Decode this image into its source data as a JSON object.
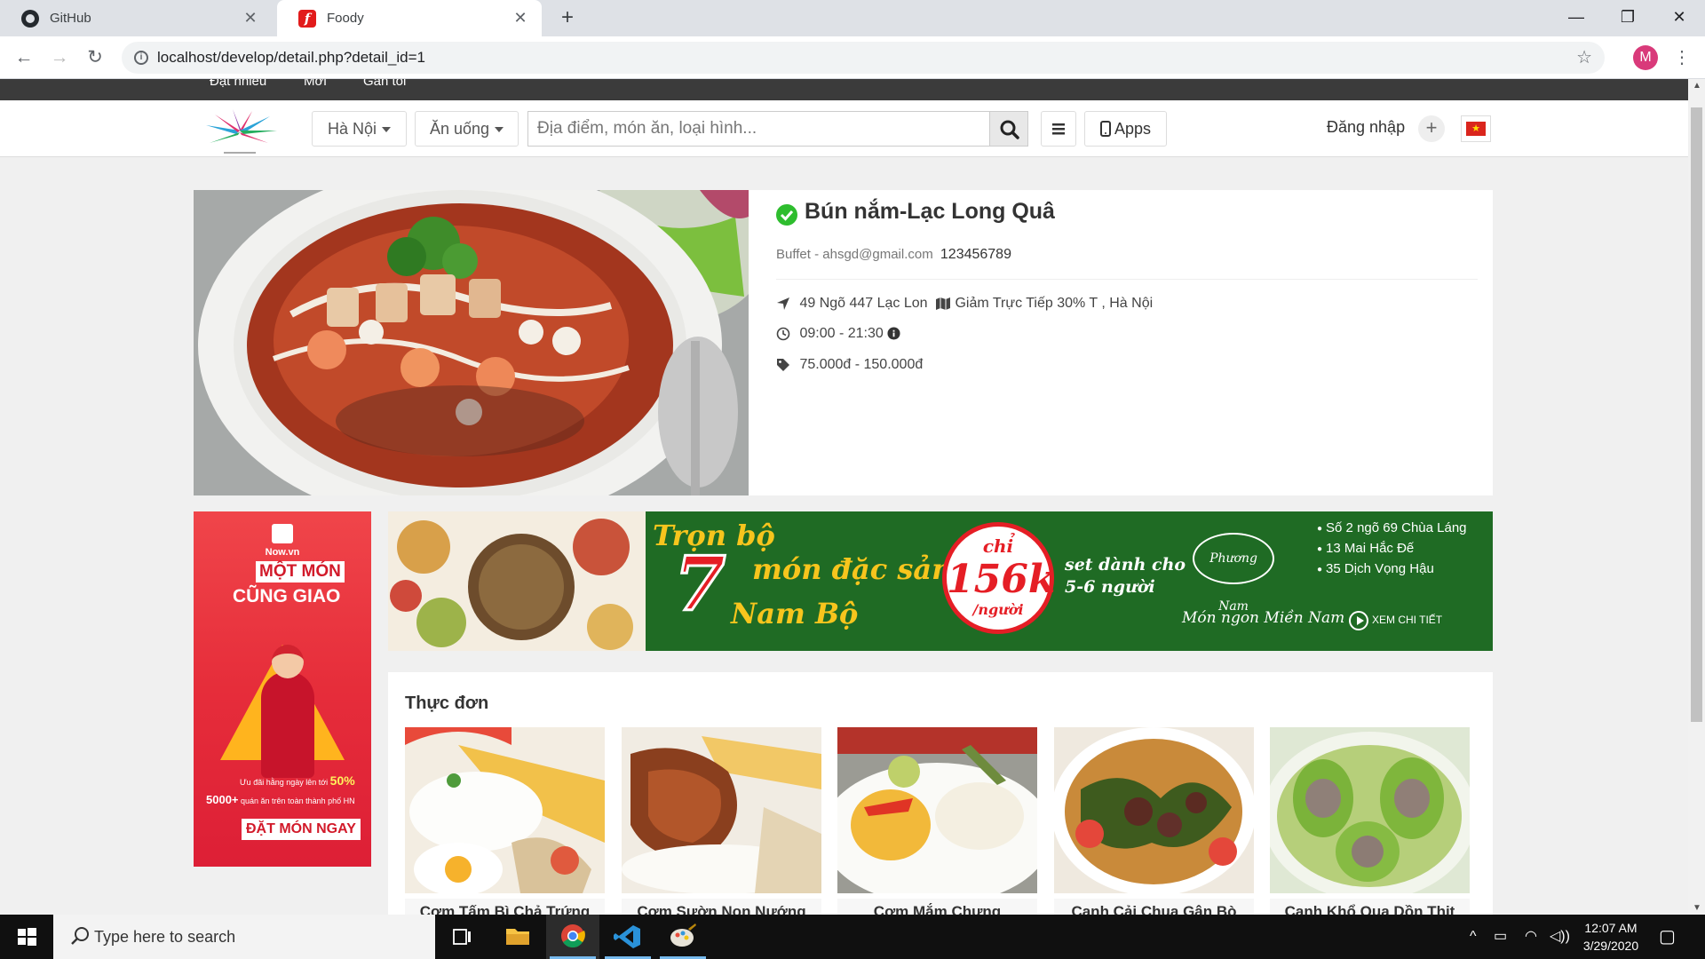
{
  "browser": {
    "tabs": [
      {
        "title": "GitHub",
        "icon": "github-icon",
        "active": false
      },
      {
        "title": "Foody",
        "icon": "foody-favicon",
        "active": true
      }
    ],
    "url": "localhost/develop/detail.php?detail_id=1",
    "profile_initial": "M"
  },
  "topnav": {
    "items": [
      "Đặt nhiều",
      "Mới",
      "Gần tôi"
    ]
  },
  "header": {
    "city": "Hà Nội",
    "category": "Ăn uống",
    "search_placeholder": "Địa điểm, món ăn, loại hình...",
    "apps_label": "Apps",
    "login_label": "Đăng nhập",
    "plus_label": "+"
  },
  "restaurant": {
    "name": "Bún nắm-Lạc Long Quâ",
    "type": "Buffet",
    "separator": " - ",
    "email": "ahsgd@gmail.com",
    "phone": "123456789",
    "address": "49 Ngõ 447 Lạc Lon",
    "promo": "Giảm Trực Tiếp 30% T",
    "city": ", Hà Nội",
    "hours": "09:00 - 21:30",
    "price_range": "75.000đ - 150.000đ",
    "verified": true
  },
  "side_ad": {
    "brand": "Now.vn",
    "headline1": "MỘT MÓN",
    "headline2": "CŨNG GIAO",
    "promo1_prefix": "Ưu đãi hằng ngày lên tới ",
    "promo1_value": "50%",
    "promo2_prefix": "5000+",
    "promo2_suffix": " quán ăn trên toàn thành phố HN",
    "cta": "ĐẶT MÓN NGAY",
    "colors": {
      "bg": "#e62d3a",
      "accent": "#ffb41e"
    }
  },
  "wide_banner": {
    "line1": "Trọn bộ",
    "number": "7",
    "line2": "món đặc sản",
    "line3": "Nam Bộ",
    "price_prefix": "chỉ",
    "price": "156k",
    "price_unit": "/người",
    "set_line1": "set dành cho",
    "set_line2": "5-6 người",
    "logo_text": "Phương Nam",
    "slogan": "Món ngon Miền Nam",
    "addresses": [
      "Số 2 ngõ 69 Chùa Láng",
      "13 Mai Hắc Đế",
      "35 Dịch Vọng Hậu"
    ],
    "cta": "XEM CHI TIẾT",
    "colors": {
      "bg": "#1f6b24",
      "title": "#f7c51d",
      "accent": "#e51e25"
    }
  },
  "menu": {
    "title": "Thực đơn",
    "items": [
      {
        "name": "Cơm Tấm Bì Chả Trứng"
      },
      {
        "name": "Cơm Sườn Non Nướng"
      },
      {
        "name": "Cơm Mắm Chưng"
      },
      {
        "name": "Canh Cải Chua Gân Bò"
      },
      {
        "name": "Canh Khổ Qua Dồn Thịt"
      }
    ]
  },
  "taskbar": {
    "search_placeholder": "Type here to search",
    "time": "12:07 AM",
    "date": "3/29/2020"
  }
}
